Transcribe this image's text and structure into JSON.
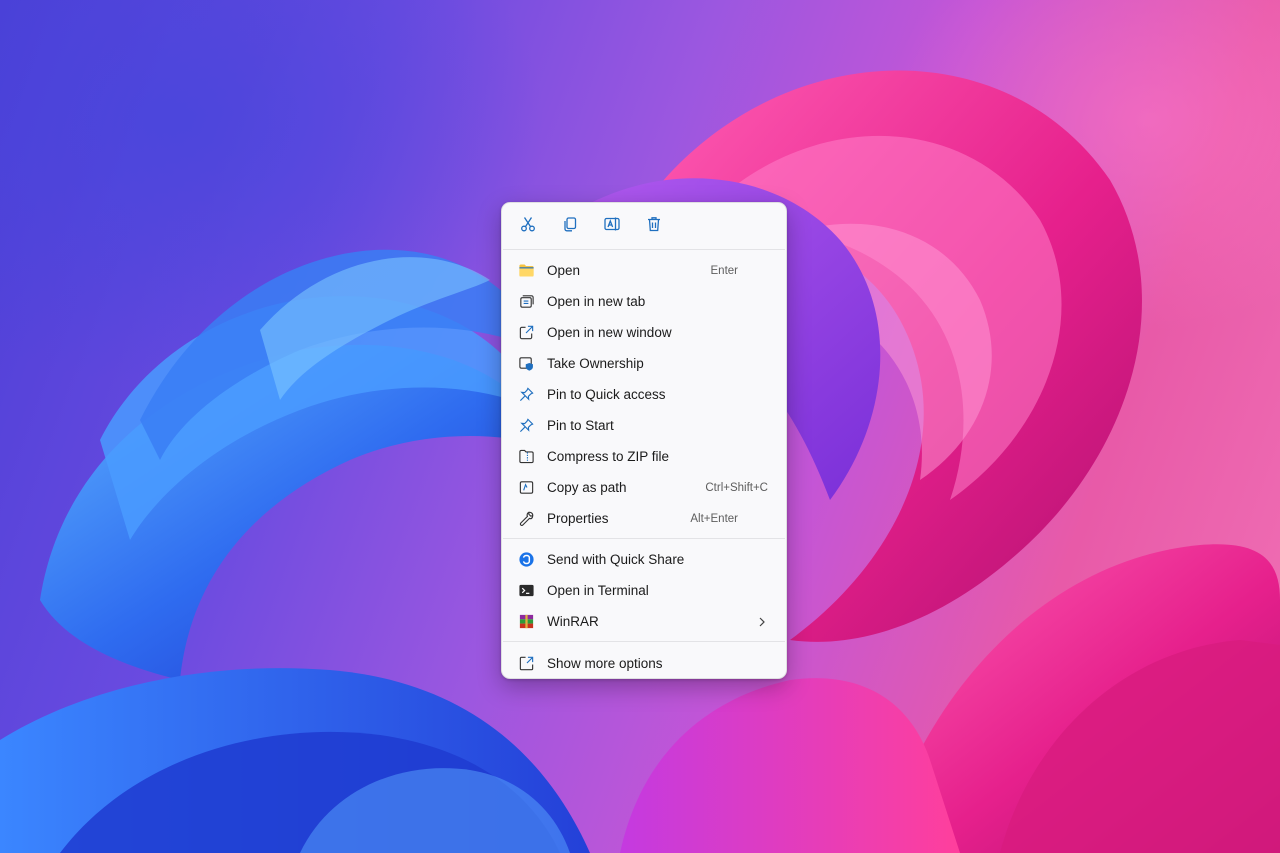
{
  "colors": {
    "menu_bg": "#f9f9fb",
    "icon_blue": "#1f6fbf",
    "folder_yellow": "#f5c342",
    "quickshare_blue": "#1a73e8"
  },
  "quick_actions": [
    {
      "name": "cut",
      "icon": "scissors-icon"
    },
    {
      "name": "copy",
      "icon": "copy-icon"
    },
    {
      "name": "rename",
      "icon": "rename-icon"
    },
    {
      "name": "delete",
      "icon": "trash-icon"
    }
  ],
  "menu": {
    "items": [
      {
        "label": "Open",
        "shortcut": "Enter",
        "icon": "folder-icon"
      },
      {
        "label": "Open in new tab",
        "shortcut": "",
        "icon": "new-tab-icon"
      },
      {
        "label": "Open in new window",
        "shortcut": "",
        "icon": "new-window-icon"
      },
      {
        "label": "Take Ownership",
        "shortcut": "",
        "icon": "ownership-shield-icon"
      },
      {
        "label": "Pin to Quick access",
        "shortcut": "",
        "icon": "pin-icon"
      },
      {
        "label": "Pin to Start",
        "shortcut": "",
        "icon": "pin-icon"
      },
      {
        "label": "Compress to ZIP file",
        "shortcut": "",
        "icon": "zip-folder-icon"
      },
      {
        "label": "Copy as path",
        "shortcut": "Ctrl+Shift+C",
        "icon": "copy-path-icon"
      },
      {
        "label": "Properties",
        "shortcut": "Alt+Enter",
        "icon": "wrench-icon"
      }
    ],
    "items2": [
      {
        "label": "Send with Quick Share",
        "icon": "quick-share-icon"
      },
      {
        "label": "Open in Terminal",
        "icon": "terminal-icon"
      },
      {
        "label": "WinRAR",
        "icon": "winrar-icon"
      }
    ],
    "more": {
      "label": "Show more options",
      "icon": "show-more-icon"
    }
  }
}
